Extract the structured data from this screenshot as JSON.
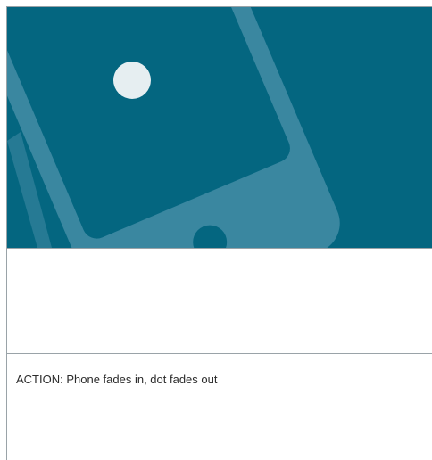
{
  "storyboard": {
    "action_text": "ACTION: Phone fades in, dot fades out"
  },
  "colors": {
    "panel_background": "#046680",
    "phone_body": "#3a87a0",
    "phone_screen": "#046680",
    "dot": "#e6eef1",
    "divider": "#9aa3a8"
  },
  "icons": {
    "phone": "phone-illustration",
    "dot": "white-dot"
  }
}
